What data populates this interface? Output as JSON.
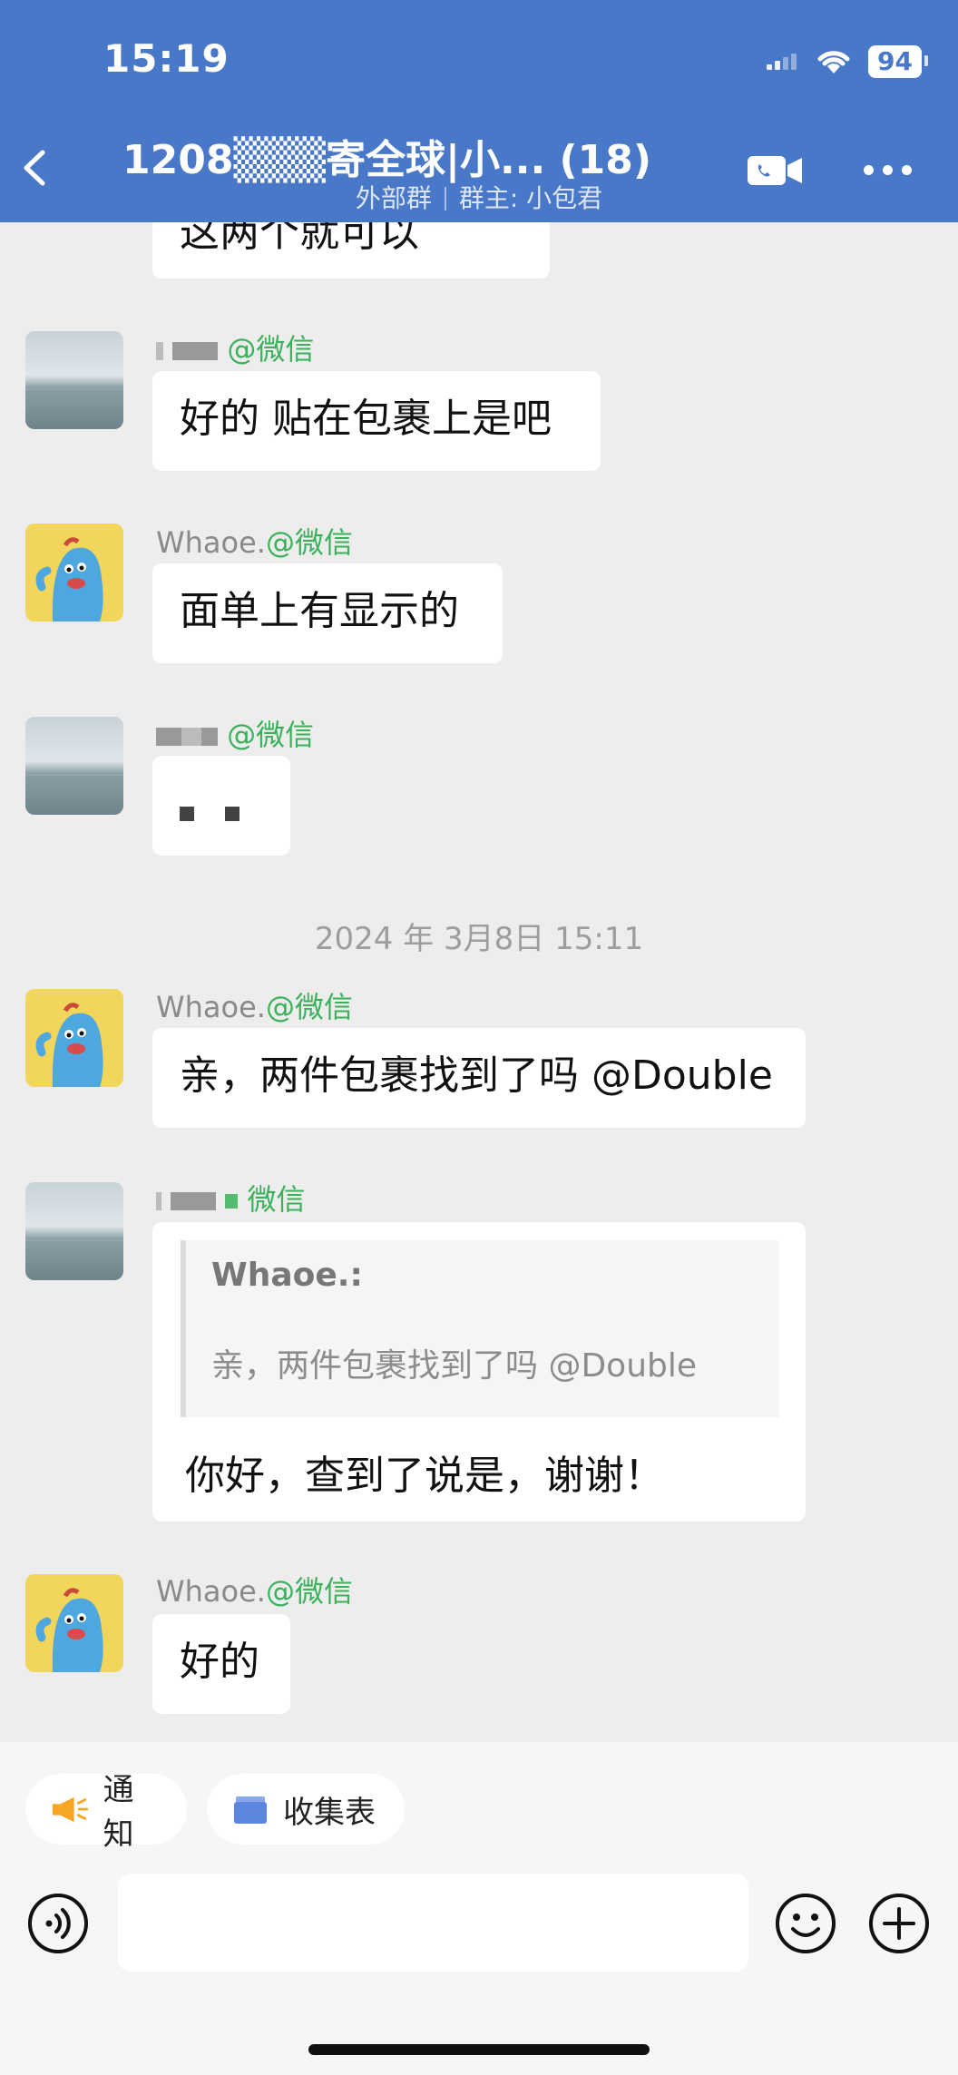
{
  "status": {
    "time": "15:19",
    "battery": "94"
  },
  "header": {
    "title": "1208▒▒▒寄全球|小... (18)",
    "subtitle_left": "外部群",
    "subtitle_right": "群主: 小包君"
  },
  "messages": [
    {
      "text_top_cut": "这两个就可以"
    },
    {
      "sender_suffix": "@微信",
      "text": "好的 贴在包裹上是吧"
    },
    {
      "sender": "Whaoe.",
      "sender_suffix": "@微信",
      "text": "面单上有显示的"
    },
    {
      "sender_suffix": "@微信",
      "text": ""
    },
    {
      "timestamp": "2024 年 3月8日 15:11"
    },
    {
      "sender": "Whaoe.",
      "sender_suffix": "@微信",
      "text": "亲，两件包裹找到了吗 @Double"
    },
    {
      "sender_suffix": "微信",
      "quote_name": "Whaoe.:",
      "quote_text": "亲，两件包裹找到了吗 @Double",
      "text": "你好，查到了说是，谢谢！"
    },
    {
      "sender": "Whaoe.",
      "sender_suffix": "@微信",
      "text": "好的"
    }
  ],
  "toolbar": {
    "notice_label": "通知",
    "form_label": "收集表"
  },
  "icons": {
    "back": "chevron-left-icon",
    "call": "video-call-icon",
    "more": "more-dots-icon",
    "notice": "megaphone-icon",
    "form": "collection-form-icon",
    "voice": "voice-icon",
    "emoji": "emoji-icon",
    "plus": "plus-icon"
  },
  "colors": {
    "header": "#4a78c9",
    "wechat_tag": "#3bb15b",
    "background": "#ededed"
  }
}
